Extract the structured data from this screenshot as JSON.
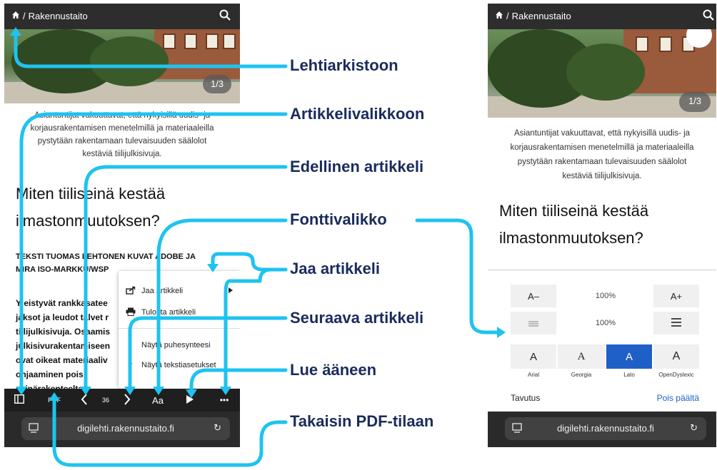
{
  "breadcrumb": {
    "home_icon": "home-icon",
    "section": "Rakennustaito"
  },
  "search_icon": "search-icon",
  "gallery": {
    "left_counter": "1/3",
    "right_counter": "1/3"
  },
  "caption": [
    "Asiantuntijat vakuuttavat, että nykyisillä uudis- ja",
    "korjausrakentamisen menetelmillä ja materiaaleilla",
    "pystytään rakentamaan tulevaisuuden säälolot",
    "kestäviä tiilijulkisivuja."
  ],
  "headline": [
    "Miten tiiliseinä kestää",
    "ilmastonmuutoksen?"
  ],
  "byline": [
    "TEKSTI TUOMAS LEHTONEN KUVAT ADOBE JA",
    "MIRA ISO-MARKKU/WSP"
  ],
  "body_lines": [
    "Yleistyvät rankkasatee",
    "jaksot ja leudot talvet r",
    "tiilijulkisivuja. Osaamis",
    "julkisivurakentamiseen",
    "ovat oikeat materiaaliv",
    "ohjaaminen pois seinärakenteelta."
  ],
  "toolbar": {
    "pdf": "PDF",
    "page": "36",
    "font": "Aa",
    "more": "•••"
  },
  "url": "digilehti.rakennustaito.fi",
  "menu": {
    "share": "Jaa artikkeli",
    "print": "Tulosta artikkeli",
    "speech": "Näytä puhesynteesi",
    "text_settings": "Näytä tekstiasetukset"
  },
  "font_panel": {
    "decrease": "A–",
    "increase": "A+",
    "size": "100%",
    "line_spacing": "100%",
    "fonts": [
      {
        "glyph": "A",
        "name": "Arial"
      },
      {
        "glyph": "A",
        "name": "Georgia"
      },
      {
        "glyph": "A",
        "name": "Lato"
      },
      {
        "glyph": "A",
        "name": "OpenDyslexic"
      }
    ],
    "hyphenation_label": "Tavutus",
    "hyphenation_value": "Pois päältä",
    "selected_color": "#1f5fc8"
  },
  "callouts": {
    "archive": "Lehtiarkistoon",
    "article_menu": "Artikkelivalikkoon",
    "previous": "Edellinen artikkeli",
    "font_menu": "Fonttivalikko",
    "share": "Jaa artikkeli",
    "next": "Seuraava artikkeli",
    "read_aloud": "Lue ääneen",
    "pdf_mode": "Takaisin PDF-tilaan"
  },
  "colors": {
    "arrow": "#1ec3f0",
    "callout_text": "#1a2b5c",
    "toolbar": "#1f1f1f"
  }
}
